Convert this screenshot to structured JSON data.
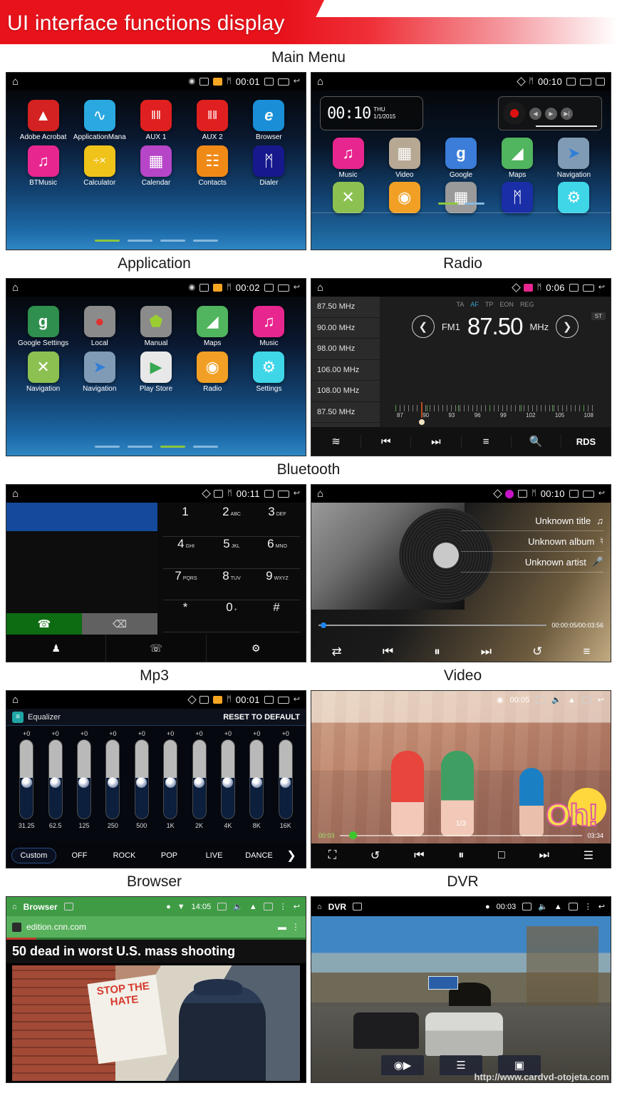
{
  "banner": {
    "title": "UI interface functions display"
  },
  "captions": {
    "row1": "Main Menu",
    "row2_left": "Application",
    "row2_right": "Radio",
    "row3": "Bluetooth",
    "row4_left": "Mp3",
    "row4_right": "Video",
    "row5_left": "Browser",
    "row5_right": "DVR"
  },
  "statusbar": {
    "home_icon": "home-icon",
    "gps_icon": "gps-icon",
    "image_icon": "image-icon",
    "radio_icon": "radio-icon",
    "bluetooth_icon": "bluetooth-icon",
    "camera_icon": "camera-icon",
    "recents_icon": "recents-icon",
    "back_icon": "back-icon"
  },
  "screen_app1": {
    "time": "00:01",
    "apps": [
      {
        "label": "Adobe Acrobat",
        "icon": "pdf-icon",
        "color": "#d32221",
        "glyph": "⮟"
      },
      {
        "label": "ApplicationMana",
        "icon": "app-manager-icon",
        "color": "#2aa9e0",
        "glyph": "∿"
      },
      {
        "label": "AUX 1",
        "icon": "aux-icon",
        "color": "#e02020",
        "glyph": "‖‖"
      },
      {
        "label": "AUX 2",
        "icon": "aux-icon",
        "color": "#e02020",
        "glyph": "‖‖"
      },
      {
        "label": "Browser",
        "icon": "ie-browser-icon",
        "color": "#1a8fd8",
        "glyph": "e"
      },
      {
        "label": "BTMusic",
        "icon": "bluetooth-music-icon",
        "color": "#e8268f",
        "glyph": "♫"
      },
      {
        "label": "Calculator",
        "icon": "calculator-icon",
        "color": "#efc319",
        "glyph": "÷"
      },
      {
        "label": "Calendar",
        "icon": "calendar-icon",
        "color": "#b645c8",
        "glyph": "▦"
      },
      {
        "label": "Contacts",
        "icon": "contacts-icon",
        "color": "#f08a17",
        "glyph": "☷"
      },
      {
        "label": "Dialer",
        "icon": "dialer-bluetooth-icon",
        "color": "#16188c",
        "glyph": "ᛗ"
      }
    ],
    "pages": 4,
    "active_page": 1
  },
  "screen_home": {
    "time": "00:10",
    "clock_widget": {
      "time": "00:10",
      "weekday": "THU",
      "date": "1/1/2015"
    },
    "media_widget": {
      "prev_icon": "prev-icon",
      "play_icon": "play-icon",
      "next_icon": "next-icon"
    },
    "apps": [
      {
        "label": "Music",
        "icon": "music-icon",
        "color": "#e8268f",
        "glyph": "♫"
      },
      {
        "label": "Video",
        "icon": "video-icon",
        "color": "#b7a894",
        "glyph": "🎬"
      },
      {
        "label": "Google",
        "icon": "google-icon",
        "color": "#3b7dd8",
        "glyph": "g"
      },
      {
        "label": "Maps",
        "icon": "maps-icon",
        "color": "#51b45f",
        "glyph": "◢"
      },
      {
        "label": "Navigation",
        "icon": "navigation-icon",
        "color": "#7f9bb5",
        "glyph": "➤"
      },
      {
        "label": "",
        "icon": "navigation-local-icon",
        "color": "#8cc152",
        "glyph": "✕"
      },
      {
        "label": "",
        "icon": "radio-icon",
        "color": "#f2a025",
        "glyph": "◉"
      },
      {
        "label": "",
        "icon": "apps-icon",
        "color": "#9a9a9a",
        "glyph": "▦"
      },
      {
        "label": "",
        "icon": "bluetooth-icon",
        "color": "#1a2ea8",
        "glyph": "ᛗ"
      },
      {
        "label": "",
        "icon": "settings-icon",
        "color": "#3fd6e8",
        "glyph": "⚙"
      }
    ],
    "pages": 2,
    "active_page": 0
  },
  "screen_app2": {
    "time": "00:02",
    "apps": [
      {
        "label": "Google Settings",
        "icon": "google-settings-icon",
        "color": "#2f8f4e",
        "glyph": "g"
      },
      {
        "label": "Local",
        "icon": "local-pin-icon",
        "color": "#8b8b8b",
        "glyph": "📍"
      },
      {
        "label": "Manual",
        "icon": "android-manual-icon",
        "color": "#8b8b8b",
        "glyph": "⬟"
      },
      {
        "label": "Maps",
        "icon": "maps-icon",
        "color": "#51b45f",
        "glyph": "◢"
      },
      {
        "label": "Music",
        "icon": "music-icon",
        "color": "#e8268f",
        "glyph": "♫"
      },
      {
        "label": "Navigation",
        "icon": "navigation-local-icon",
        "color": "#8cc152",
        "glyph": "✕"
      },
      {
        "label": "Navigation",
        "icon": "navigation-icon",
        "color": "#7f9bb5",
        "glyph": "➤"
      },
      {
        "label": "Play Store",
        "icon": "play-store-icon",
        "color": "#e8e8e8",
        "glyph": "▶"
      },
      {
        "label": "Radio",
        "icon": "radio-icon",
        "color": "#f2a025",
        "glyph": "◉"
      },
      {
        "label": "Settings",
        "icon": "settings-icon",
        "color": "#3fd6e8",
        "glyph": "⚙"
      }
    ],
    "pages": 4,
    "active_page": 2
  },
  "screen_radio": {
    "time": "0:06",
    "presets": [
      "87.50  MHz",
      "90.00  MHz",
      "98.00  MHz",
      "106.00  MHz",
      "108.00  MHz",
      "87.50  MHz"
    ],
    "rds_flags": [
      {
        "label": "TA",
        "active": false
      },
      {
        "label": "AF",
        "active": true
      },
      {
        "label": "TP",
        "active": false
      },
      {
        "label": "EON",
        "active": false
      },
      {
        "label": "REG",
        "active": false
      }
    ],
    "stereo_badge": "ST",
    "band": "FM1",
    "frequency": "87.50",
    "unit": "MHz",
    "scale_ticks": [
      "87",
      "90",
      "93",
      "96",
      "99",
      "102",
      "105",
      "108"
    ],
    "bottom_bar": [
      {
        "label": "",
        "icon": "radio-wave-icon",
        "glyph": "≋"
      },
      {
        "label": "",
        "icon": "previous-icon",
        "glyph": "⏮"
      },
      {
        "label": "",
        "icon": "next-icon",
        "glyph": "⏭"
      },
      {
        "label": "",
        "icon": "equalizer-icon",
        "glyph": "≡"
      },
      {
        "label": "",
        "icon": "search-icon",
        "glyph": "⚲"
      },
      {
        "label": "RDS",
        "icon": "rds-label",
        "glyph": ""
      }
    ]
  },
  "screen_bluetooth": {
    "time": "00:11",
    "keys": [
      {
        "num": "1",
        "sub": ""
      },
      {
        "num": "2",
        "sub": "ABC"
      },
      {
        "num": "3",
        "sub": "DEF"
      },
      {
        "num": "4",
        "sub": "GHI"
      },
      {
        "num": "5",
        "sub": "JKL"
      },
      {
        "num": "6",
        "sub": "MNO"
      },
      {
        "num": "7",
        "sub": "PQRS"
      },
      {
        "num": "8",
        "sub": "TUV"
      },
      {
        "num": "9",
        "sub": "WXYZ"
      },
      {
        "num": "*",
        "sub": ""
      },
      {
        "num": "0",
        "sub": "+"
      },
      {
        "num": "#",
        "sub": ""
      }
    ],
    "call_icon": "call-icon",
    "delete_icon": "backspace-icon",
    "bottom_bar": [
      {
        "icon": "contacts-icon",
        "glyph": "⛃"
      },
      {
        "icon": "call-log-icon",
        "glyph": "⌕"
      },
      {
        "icon": "settings-icon",
        "glyph": "⚙"
      }
    ]
  },
  "screen_mp3": {
    "time": "00:10",
    "title": "Unknown title",
    "album": "Unknown album",
    "artist": "Unknown artist",
    "elapsed_total": "00:00:05/00:03:56",
    "controls": [
      {
        "icon": "shuffle-icon",
        "glyph": "⇄"
      },
      {
        "icon": "previous-icon",
        "glyph": "⏮"
      },
      {
        "icon": "pause-icon",
        "glyph": "⏸"
      },
      {
        "icon": "next-icon",
        "glyph": "⏭"
      },
      {
        "icon": "repeat-icon",
        "glyph": "↺"
      },
      {
        "icon": "equalizer-icon",
        "glyph": "≡"
      }
    ]
  },
  "screen_video": {
    "time": "00:05",
    "elapsed": "00:03",
    "duration": "03:34",
    "counter": "1/3",
    "overlay_text": "Oh!",
    "controls": [
      {
        "icon": "fullscreen-icon",
        "glyph": "⛶"
      },
      {
        "icon": "repeat-icon",
        "glyph": "↺"
      },
      {
        "icon": "previous-icon",
        "glyph": "⏮"
      },
      {
        "icon": "pause-icon",
        "glyph": "⏸"
      },
      {
        "icon": "stop-icon",
        "glyph": "□"
      },
      {
        "icon": "next-icon",
        "glyph": "⏭"
      },
      {
        "icon": "playlist-icon",
        "glyph": "☰"
      }
    ]
  },
  "screen_equalizer": {
    "time": "00:01",
    "header_title": "Equalizer",
    "reset_label": "RESET TO DEFAULT",
    "bands": [
      {
        "hz": "31.25",
        "value": "+0"
      },
      {
        "hz": "62.5",
        "value": "+0"
      },
      {
        "hz": "125",
        "value": "+0"
      },
      {
        "hz": "250",
        "value": "+0"
      },
      {
        "hz": "500",
        "value": "+0"
      },
      {
        "hz": "1K",
        "value": "+0"
      },
      {
        "hz": "2K",
        "value": "+0"
      },
      {
        "hz": "4K",
        "value": "+0"
      },
      {
        "hz": "8K",
        "value": "+0"
      },
      {
        "hz": "16K",
        "value": "+0"
      }
    ],
    "presets": [
      "Custom",
      "OFF",
      "ROCK",
      "POP",
      "LIVE",
      "DANCE"
    ],
    "selected_preset": "Custom",
    "more_icon": "chevron-right-icon"
  },
  "screen_browser": {
    "app_title": "Browser",
    "time": "14:05",
    "url": "edition.cnn.com",
    "headline": "50 dead in worst U.S. mass shooting",
    "sign_text": "STOP THE HATE"
  },
  "screen_dvr": {
    "app_title": "DVR",
    "time": "00:03",
    "watermark": "http://www.cardvd-otojeta.com",
    "controls": [
      {
        "icon": "camcorder-icon",
        "glyph": "🎥"
      },
      {
        "icon": "list-icon",
        "glyph": "☰"
      },
      {
        "icon": "camera-icon",
        "glyph": "📷"
      }
    ]
  },
  "colors": {
    "banner_red": "#e8121b",
    "browser_green": "#3f9c45",
    "accent_blue": "#35a7d8",
    "pager_active": "#8ec63f"
  }
}
